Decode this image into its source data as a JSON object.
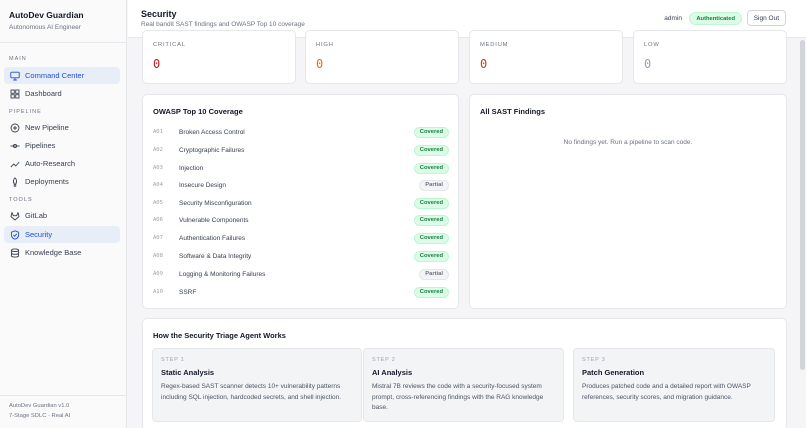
{
  "app": {
    "title": "AutoDev Guardian",
    "subtitle": "Autonomous AI Engineer"
  },
  "sidebar": {
    "sections": [
      {
        "label": "MAIN"
      },
      {
        "label": "PIPELINE"
      },
      {
        "label": "TOOLS"
      }
    ],
    "items": [
      {
        "label": "Command Center",
        "icon": "monitor-icon",
        "active": true
      },
      {
        "label": "Dashboard",
        "icon": "grid-icon"
      },
      {
        "label": "New Pipeline",
        "icon": "plus-circle-icon"
      },
      {
        "label": "Pipelines",
        "icon": "pipeline-icon"
      },
      {
        "label": "Auto-Research",
        "icon": "trend-icon"
      },
      {
        "label": "Deployments",
        "icon": "rocket-icon"
      },
      {
        "label": "GitLab",
        "icon": "gitlab-icon"
      },
      {
        "label": "Security",
        "icon": "shield-icon",
        "active": true
      },
      {
        "label": "Knowledge Base",
        "icon": "database-icon"
      }
    ],
    "footer": {
      "line1": "AutoDev Guardian v1.0",
      "line2": "7-Stage SDLC · Real AI"
    }
  },
  "header": {
    "title": "Security",
    "subtitle": "Real bandit SAST findings and OWASP Top 10 coverage",
    "user": "admin",
    "auth_badge": "Authenticated",
    "signout": "Sign Out"
  },
  "stats": [
    {
      "label": "CRITICAL",
      "value": "0",
      "color": "#b91c1c"
    },
    {
      "label": "HIGH",
      "value": "0",
      "color": "#d97706"
    },
    {
      "label": "MEDIUM",
      "value": "0",
      "color": "#c2410c"
    },
    {
      "label": "LOW",
      "value": "0",
      "color": "#94a3b8"
    }
  ],
  "owasp": {
    "title": "OWASP Top 10 Coverage",
    "rows": [
      {
        "id": "A01",
        "name": "Broken Access Control",
        "status": "Covered"
      },
      {
        "id": "A02",
        "name": "Cryptographic Failures",
        "status": "Covered"
      },
      {
        "id": "A03",
        "name": "Injection",
        "status": "Covered"
      },
      {
        "id": "A04",
        "name": "Insecure Design",
        "status": "Partial"
      },
      {
        "id": "A05",
        "name": "Security Misconfiguration",
        "status": "Covered"
      },
      {
        "id": "A06",
        "name": "Vulnerable Components",
        "status": "Covered"
      },
      {
        "id": "A07",
        "name": "Authentication Failures",
        "status": "Covered"
      },
      {
        "id": "A08",
        "name": "Software & Data Integrity",
        "status": "Covered"
      },
      {
        "id": "A09",
        "name": "Logging & Monitoring Failures",
        "status": "Partial"
      },
      {
        "id": "A10",
        "name": "SSRF",
        "status": "Covered"
      }
    ]
  },
  "findings": {
    "title": "All SAST Findings",
    "empty": "No findings yet. Run a pipeline to scan code."
  },
  "triage": {
    "title": "How the Security Triage Agent Works",
    "steps": [
      {
        "num": "STEP 1",
        "title": "Static Analysis",
        "desc": "Regex-based SAST scanner detects 10+ vulnerability patterns including SQL injection, hardcoded secrets, and shell injection."
      },
      {
        "num": "STEP 2",
        "title": "AI Analysis",
        "desc": "Mistral 7B reviews the code with a security-focused system prompt, cross-referencing findings with the RAG knowledge base."
      },
      {
        "num": "STEP 3",
        "title": "Patch Generation",
        "desc": "Produces patched code and a detailed report with OWASP references, security scores, and migration guidance."
      }
    ]
  }
}
